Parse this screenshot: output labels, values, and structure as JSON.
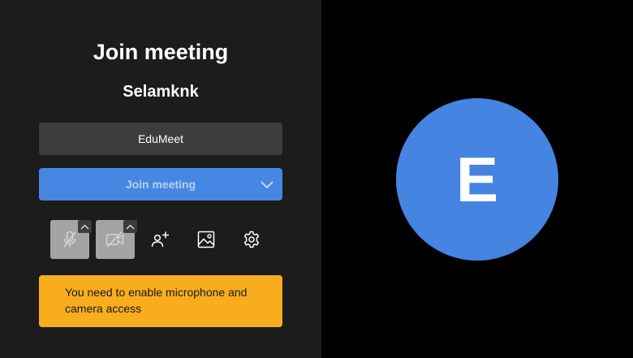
{
  "prejoin": {
    "title": "Join meeting",
    "username": "Selamknk",
    "name_field": {
      "value": "EduMeet",
      "placeholder": ""
    },
    "join_button": {
      "label": "Join meeting"
    },
    "toolbar": [
      {
        "name": "microphone",
        "icon": "microphone-off-icon",
        "state": "muted"
      },
      {
        "name": "camera",
        "icon": "camera-off-icon",
        "state": "muted"
      },
      {
        "name": "invite",
        "icon": "add-person-icon"
      },
      {
        "name": "background",
        "icon": "image-icon"
      },
      {
        "name": "settings",
        "icon": "gear-icon"
      }
    ],
    "warning": "You need to enable microphone and camera access"
  },
  "preview": {
    "avatar_initial": "E",
    "avatar_color": "#4584e0"
  },
  "colors": {
    "panel_bg": "#1c1c1c",
    "field_bg": "#3d3d3d",
    "primary": "#4787e4",
    "muted_button": "#a4a4a4",
    "warning_bg": "#f7ad1e"
  }
}
